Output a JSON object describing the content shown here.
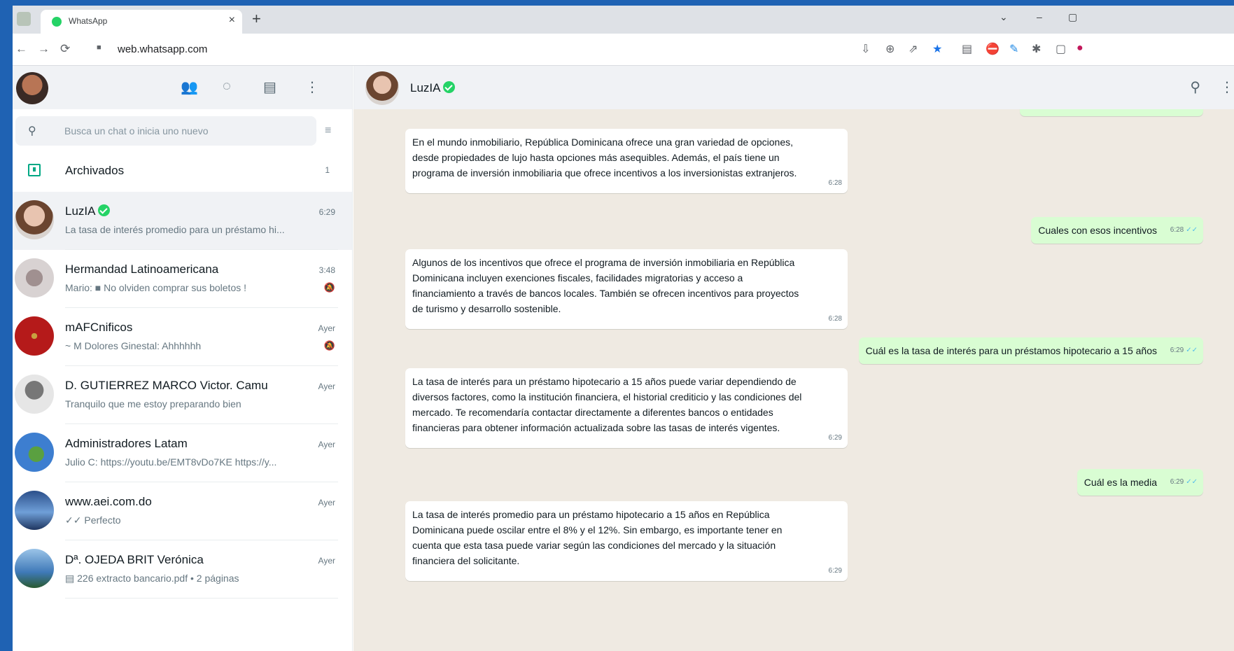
{
  "browser": {
    "tab_title": "WhatsApp",
    "tab_close": "×",
    "new_tab": "+",
    "url": "web.whatsapp.com",
    "win_minimize": "–",
    "win_maximize": "▢",
    "tab_list_chevron": "⌄"
  },
  "sidebar": {
    "search_placeholder": "Busca un chat o inicia uno nuevo",
    "archived_label": "Archivados",
    "archived_count": "1",
    "chats": [
      {
        "name": "LuzIA",
        "verified": true,
        "time": "6:29",
        "preview": "La tasa de interés promedio para un préstamo hi...",
        "active": true
      },
      {
        "name": "Hermandad Latinoamericana",
        "time": "3:48",
        "preview": "Mario: ■ No olviden comprar sus boletos !",
        "muted": true
      },
      {
        "name": "mAFCnificos",
        "time": "Ayer",
        "preview": "~ M Dolores Ginestal: Ahhhhhh",
        "muted": true
      },
      {
        "name": "D. GUTIERREZ MARCO Victor. Camu",
        "time": "Ayer",
        "preview": "Tranquilo que me estoy preparando bien"
      },
      {
        "name": "Administradores Latam",
        "time": "Ayer",
        "preview": "Julio C: https://youtu.be/EMT8vDo7KE https://y..."
      },
      {
        "name": "www.aei.com.do",
        "time": "Ayer",
        "preview": "✓✓ Perfecto"
      },
      {
        "name": "Dª. OJEDA BRIT Verónica",
        "time": "Ayer",
        "preview": "▤ 226 extracto bancario.pdf • 2 páginas"
      }
    ]
  },
  "conversation": {
    "contact_name": "LuzIA",
    "messages": [
      {
        "dir": "in",
        "text": "En el mundo inmobiliario, República Dominicana ofrece una gran variedad de opciones, desde propiedades de lujo hasta opciones más asequibles. Además, el país tiene un programa de inversión inmobiliaria que ofrece incentivos a los inversionistas extranjeros.",
        "time": "6:28"
      },
      {
        "dir": "out",
        "text": "Cuales con esos incentivos",
        "time": "6:28"
      },
      {
        "dir": "in",
        "text": "Algunos de los incentivos que ofrece el programa de inversión inmobiliaria en República Dominicana incluyen exenciones fiscales, facilidades migratorias y acceso a financiamiento a través de bancos locales. También se ofrecen incentivos para proyectos de turismo y desarrollo sostenible.",
        "time": "6:28"
      },
      {
        "dir": "out",
        "text": "Cuál es la tasa de interés para un préstamos hipotecario a 15 años",
        "time": "6:29"
      },
      {
        "dir": "in",
        "text": "La tasa de interés para un préstamo hipotecario a 15 años puede variar dependiendo de diversos factores, como la institución financiera, el historial crediticio y las condiciones del mercado. Te recomendaría contactar directamente a diferentes bancos o entidades financieras para obtener información actualizada sobre las tasas de interés vigentes.",
        "time": "6:29"
      },
      {
        "dir": "out",
        "text": "Cuál es la media",
        "time": "6:29"
      },
      {
        "dir": "in",
        "text": "La tasa de interés promedio para un préstamo hipotecario a 15 años en República Dominicana puede oscilar entre el 8% y el 12%. Sin embargo, es importante tener en cuenta que esta tasa puede variar según las condiciones del mercado y la situación financiera del solicitante.",
        "time": "6:29"
      }
    ]
  },
  "icons": {
    "back": "←",
    "forward": "→",
    "reload": "⟳",
    "lock": "🔒",
    "search": "⚲",
    "filter": "≡",
    "menu": "⋮",
    "communities": "👥",
    "status": "◌",
    "new_chat": "▤",
    "mute": "🔕"
  },
  "colors": {
    "accent": "#00a884",
    "verified": "#25d366",
    "outgoing_bubble": "#d9fdd3",
    "chat_background": "#efeae2",
    "desktop": "#1f62b3"
  }
}
